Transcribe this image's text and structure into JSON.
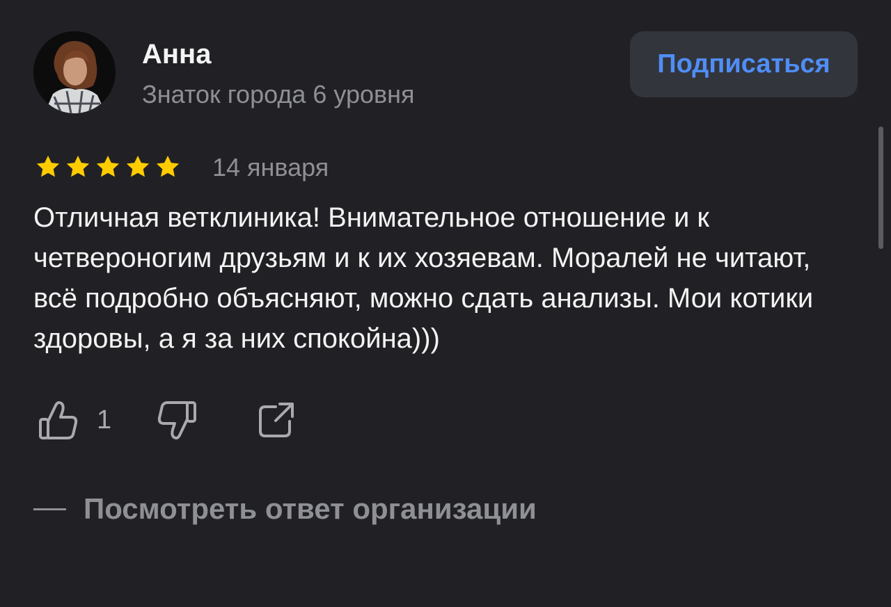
{
  "author": {
    "name": "Анна",
    "level": "Знаток города 6 уровня"
  },
  "subscribe": {
    "label": "Подписаться"
  },
  "review": {
    "rating": 5,
    "rating_max": 5,
    "date": "14 января",
    "text": "Отличная ветклиника! Внимательное отношение и к четвероногим друзьям и к их хозяевам. Моралей не читают, всё подробно объясняют, можно сдать анализы. Мои котики здоровы, а я за них спокойна)))"
  },
  "actions": {
    "like_count": "1",
    "like_icon": "thumb-up-icon",
    "dislike_icon": "thumb-down-icon",
    "share_icon": "share-icon"
  },
  "org_reply": {
    "label": "Посмотреть ответ организации"
  },
  "colors": {
    "background": "#212125",
    "accent": "#4f8ef7",
    "star": "#ffcc00",
    "muted_text": "#8f9095"
  }
}
